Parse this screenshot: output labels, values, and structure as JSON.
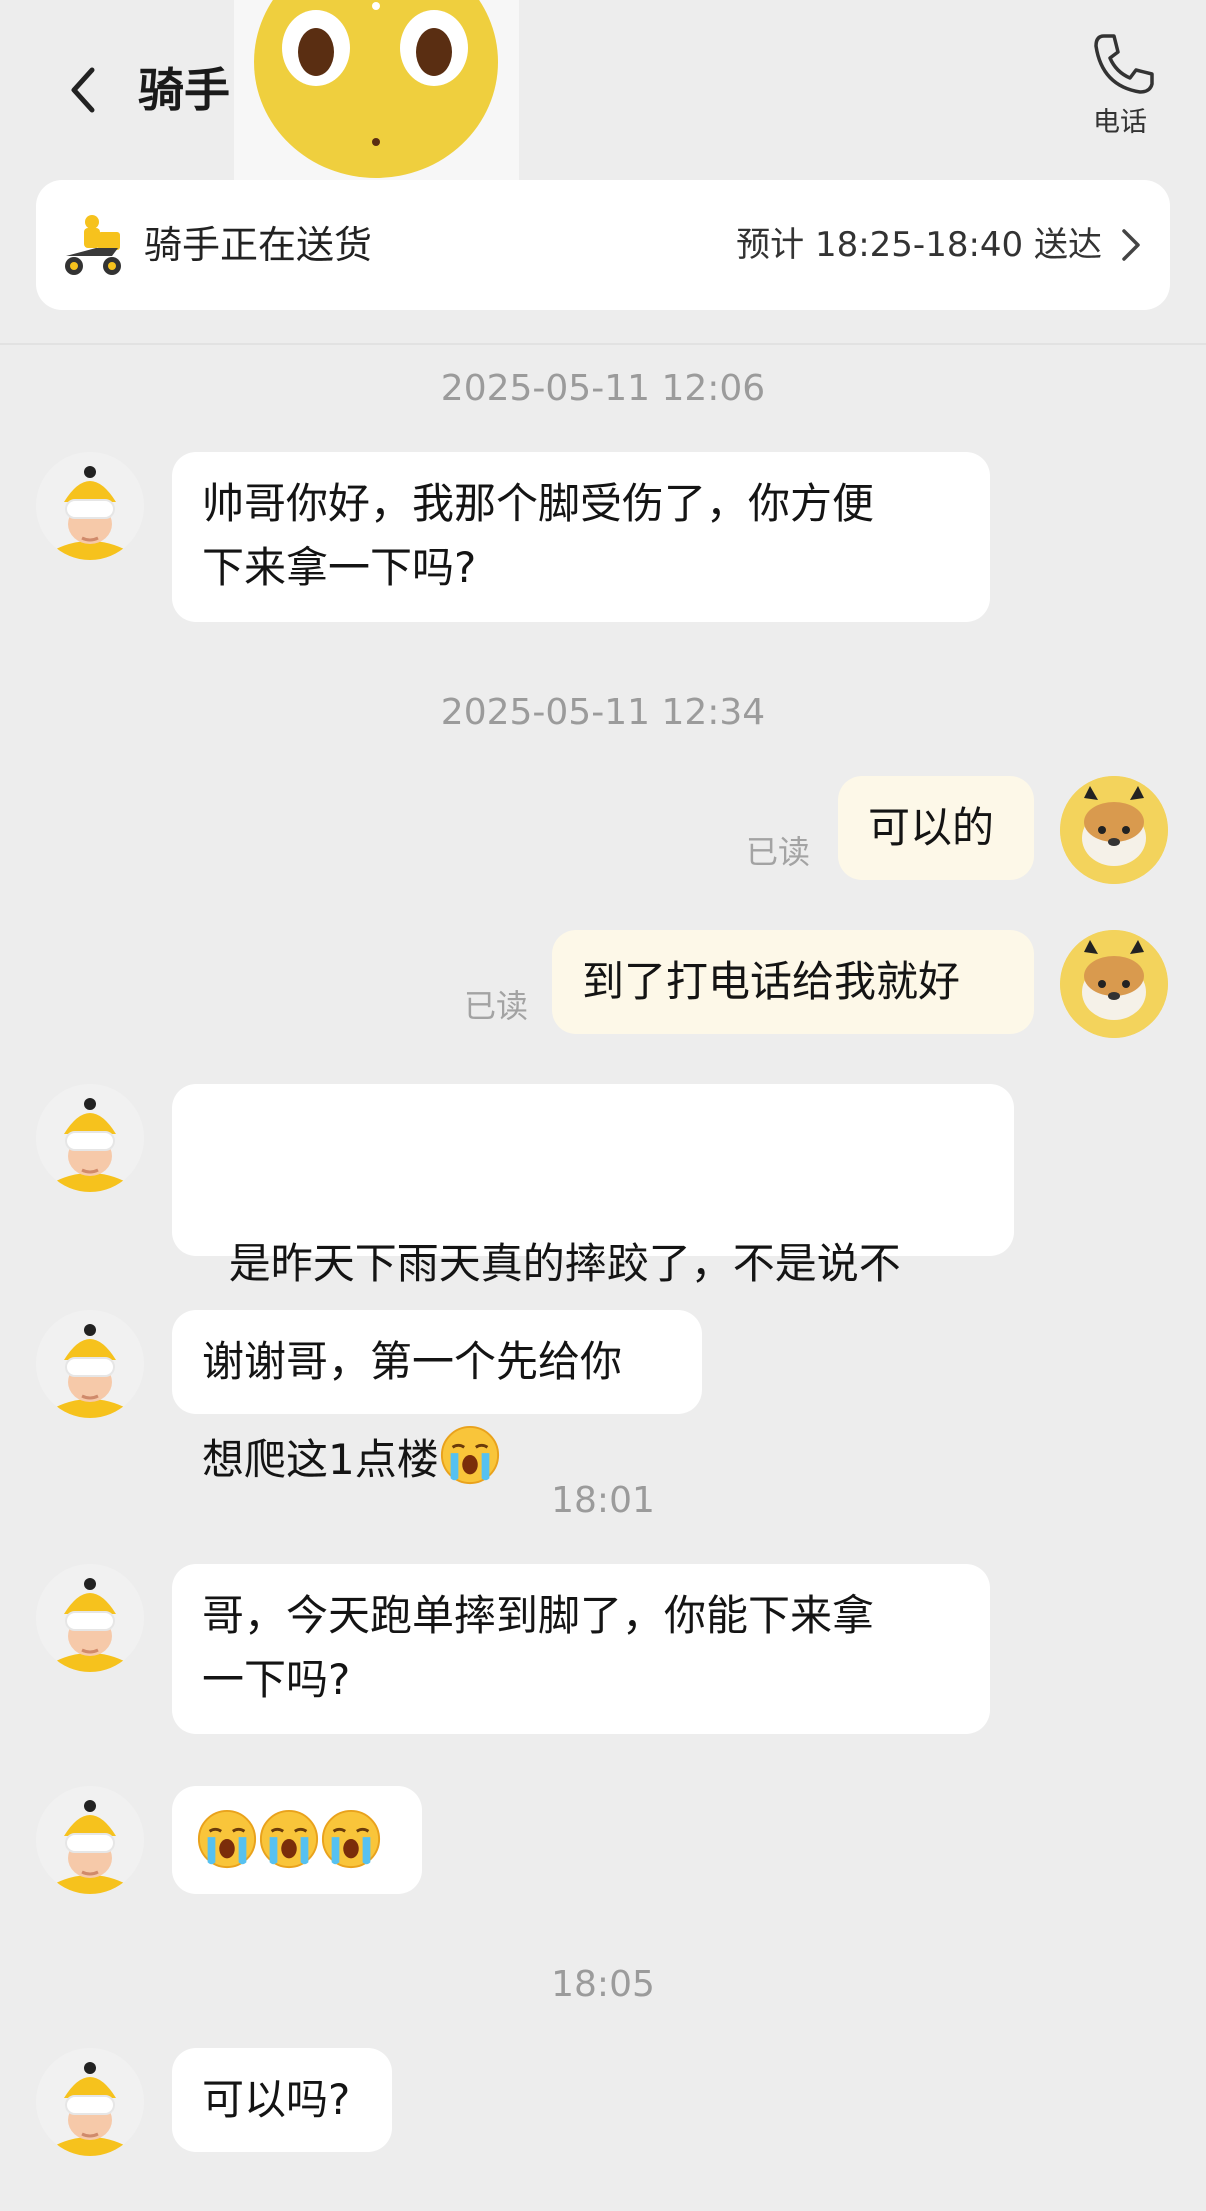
{
  "header": {
    "title": "骑手",
    "phone_label": "电话"
  },
  "status": {
    "text": "骑手正在送货",
    "eta": "预计 18:25-18:40 送达"
  },
  "timestamps": [
    "2025-05-11 12:06",
    "2025-05-11 12:34",
    "18:01",
    "18:05"
  ],
  "messages": [
    {
      "from": "rider",
      "lines": [
        "帅哥你好，我那个脚受伤了，你方便",
        "下来拿一下吗?"
      ]
    },
    {
      "from": "me",
      "text": "可以的",
      "read": "已读"
    },
    {
      "from": "me",
      "text": "到了打电话给我就好",
      "read": "已读"
    },
    {
      "from": "rider",
      "lines": [
        "  是昨天下雨天真的摔跤了，不是说不",
        "想爬这1点楼"
      ],
      "emoji": "crying-face"
    },
    {
      "from": "rider",
      "text": "谢谢哥，第一个先给你"
    },
    {
      "from": "rider",
      "lines": [
        "哥，今天跑单摔到脚了，你能下来拿",
        "一下吗?"
      ]
    },
    {
      "from": "rider",
      "emoji_count": 3,
      "emoji": "crying-face"
    },
    {
      "from": "rider",
      "text": "可以吗?"
    }
  ],
  "colors": {
    "background": "#ededed",
    "my_bubble": "#fdf8e8",
    "rider_bubble": "#ffffff",
    "helmet_yellow": "#f7c824"
  }
}
